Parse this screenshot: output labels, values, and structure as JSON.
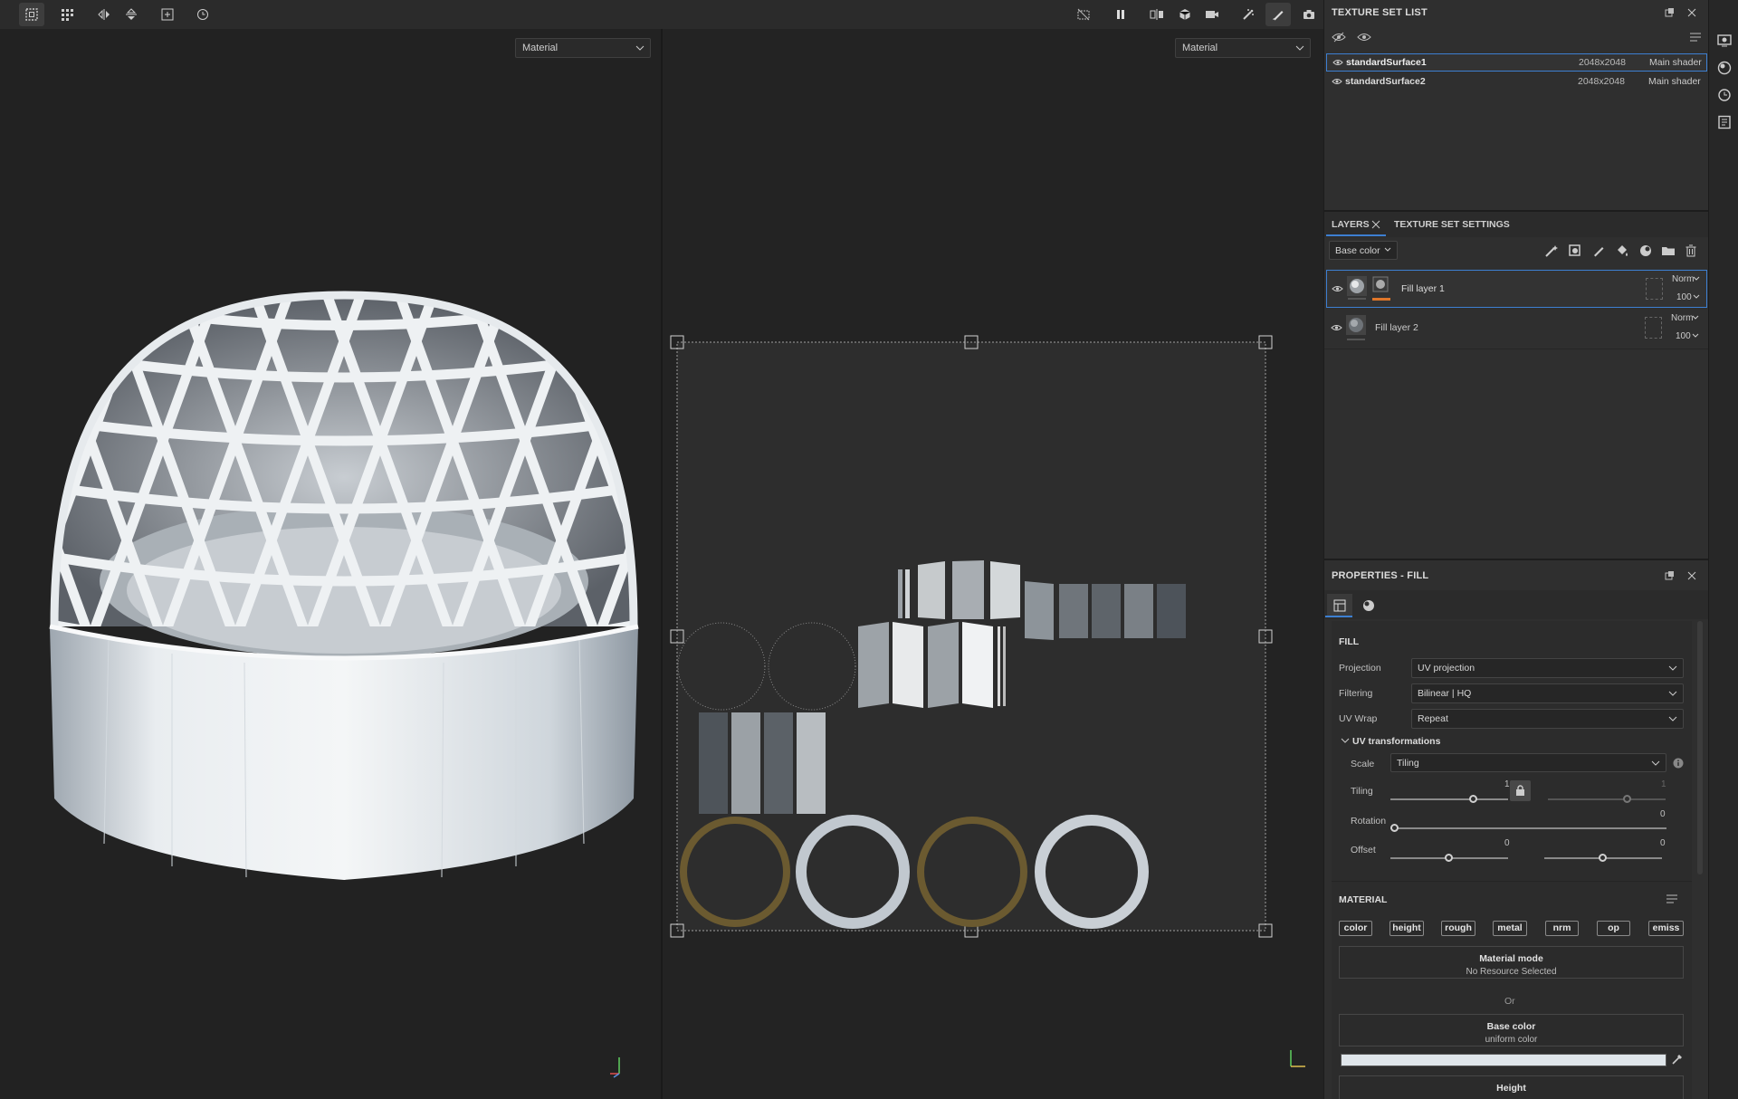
{
  "viewports": {
    "left_channel": "Material",
    "right_channel": "Material"
  },
  "texture_set_list": {
    "title": "TEXTURE SET LIST",
    "rows": [
      {
        "name": "standardSurface1",
        "size": "2048x2048",
        "shader": "Main shader"
      },
      {
        "name": "standardSurface2",
        "size": "2048x2048",
        "shader": "Main shader"
      }
    ]
  },
  "layers": {
    "tabs": [
      "LAYERS",
      "TEXTURE SET SETTINGS"
    ],
    "channel": "Base color",
    "items": [
      {
        "name": "Fill layer 1",
        "blend": "Norm",
        "opacity": "100"
      },
      {
        "name": "Fill layer 2",
        "blend": "Norm",
        "opacity": "100"
      }
    ]
  },
  "properties": {
    "title": "PROPERTIES - FILL",
    "fill_header": "FILL",
    "projection_label": "Projection",
    "projection_value": "UV projection",
    "filtering_label": "Filtering",
    "filtering_value": "Bilinear | HQ",
    "uvwrap_label": "UV Wrap",
    "uvwrap_value": "Repeat",
    "uv_transform_header": "UV transformations",
    "scale_label": "Scale",
    "scale_value": "Tiling",
    "tiling_label": "Tiling",
    "tiling_value_1": "1",
    "tiling_value_2": "1",
    "rotation_label": "Rotation",
    "rotation_value": "0",
    "offset_label": "Offset",
    "offset_value_1": "0",
    "offset_value_2": "0",
    "material_header": "MATERIAL",
    "channels": [
      "color",
      "height",
      "rough",
      "metal",
      "nrm",
      "op",
      "emiss"
    ],
    "material_mode_title": "Material mode",
    "material_mode_sub": "No Resource Selected",
    "or_label": "Or",
    "base_color_title": "Base color",
    "base_color_sub": "uniform color",
    "base_color_swatch": "#dfe5ea",
    "height_title": "Height"
  },
  "colors": {
    "selection_border": "#3d7fd1",
    "layer_accent": "#e0762a",
    "panel_bg": "#2f2f2f"
  }
}
